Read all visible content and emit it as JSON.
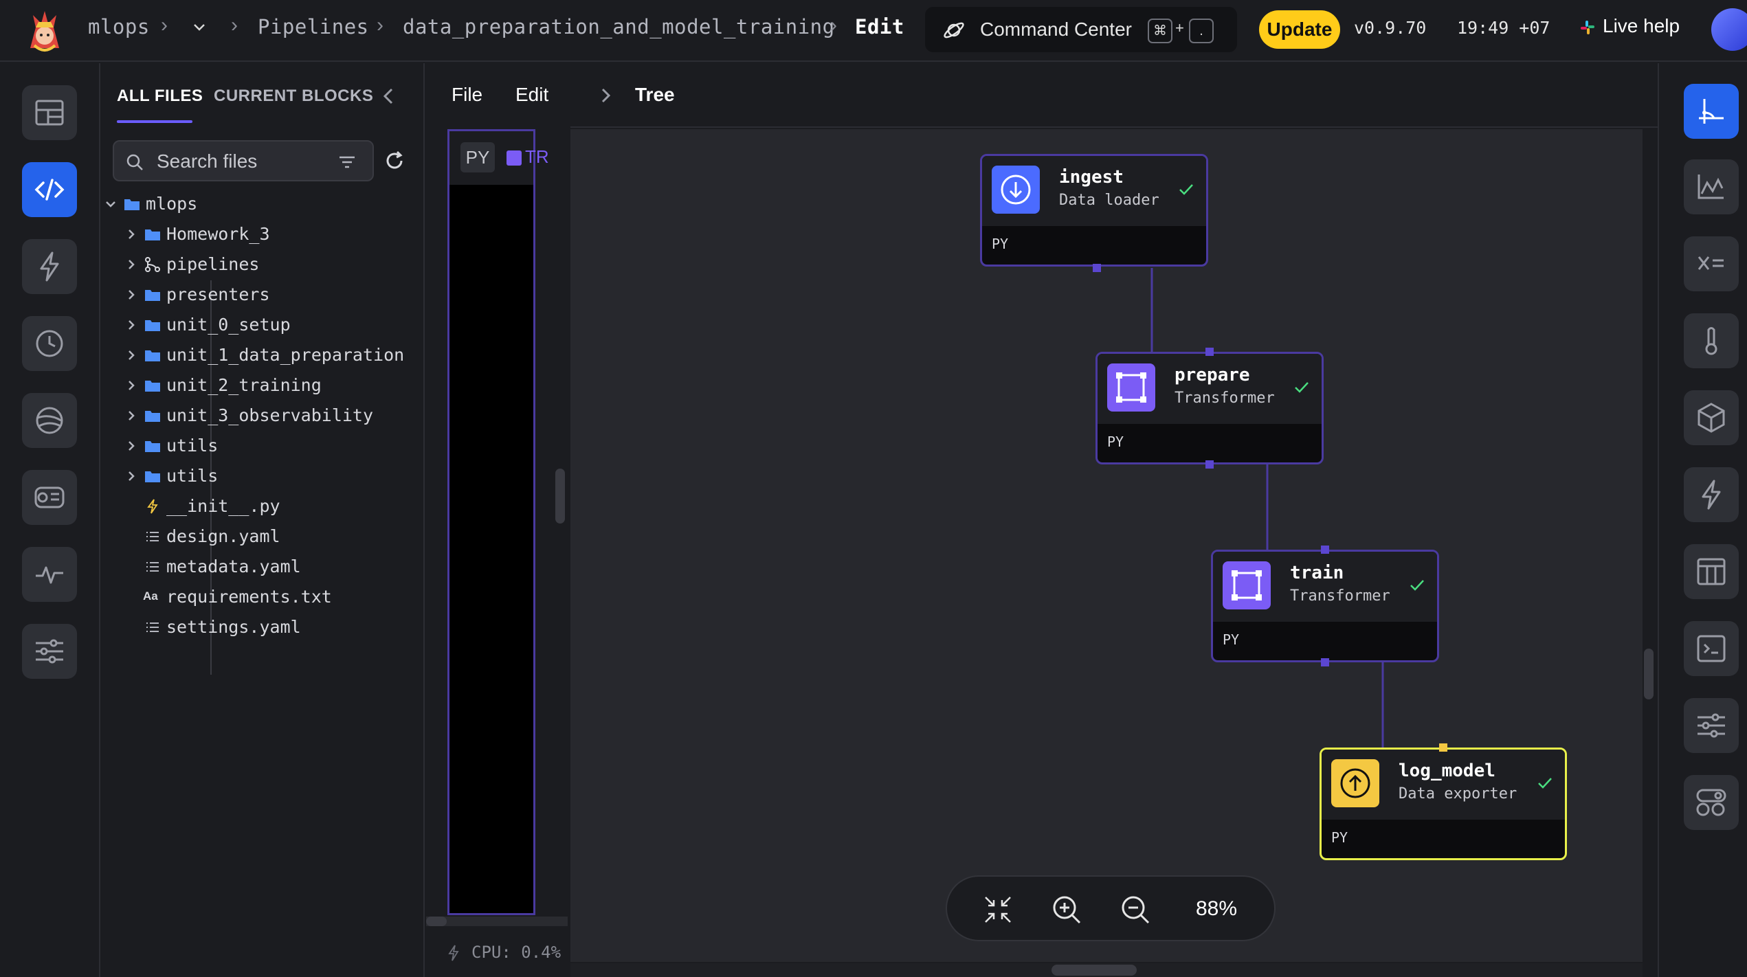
{
  "header": {
    "breadcrumbs": [
      "mlops",
      "Pipelines",
      "data_preparation_and_model_training",
      "Edit"
    ],
    "command_center_label": "Command Center",
    "shortcut_keys": [
      "⌘",
      "+",
      "."
    ],
    "update_label": "Update",
    "version": "v0.9.70",
    "time": "19:49 +07",
    "live_help_label": "Live help"
  },
  "left_rail": {
    "items": [
      "layout-icon",
      "code-icon",
      "bolt-icon",
      "clock-icon",
      "globe-icon",
      "terminal-icon",
      "pulse-icon",
      "sliders-icon"
    ],
    "active": "code-icon"
  },
  "file_panel": {
    "tabs": [
      "ALL FILES",
      "CURRENT BLOCKS"
    ],
    "active_tab": "ALL FILES",
    "search_placeholder": "Search files",
    "tree": {
      "root": "mlops",
      "folders": [
        "Homework_3",
        "pipelines",
        "presenters",
        "unit_0_setup",
        "unit_1_data_preparation",
        "unit_2_training",
        "unit_3_observability",
        "utils"
      ],
      "files": [
        "__init__.py",
        "design.yaml",
        "metadata.yaml",
        "requirements.txt",
        "settings.yaml"
      ]
    }
  },
  "editor": {
    "menu": [
      "File",
      "Edit"
    ],
    "block_tab_lang": "PY",
    "block_tab_type": "TR",
    "cpu_label": "CPU: 0.4%"
  },
  "canvas": {
    "view_label": "Tree",
    "zoom_level": "88%",
    "blocks": [
      {
        "name": "ingest",
        "type": "Data loader",
        "lang": "PY",
        "status": "success",
        "color": "#4b6bff"
      },
      {
        "name": "prepare",
        "type": "Transformer",
        "lang": "PY",
        "status": "success",
        "color": "#7b5cf5"
      },
      {
        "name": "train",
        "type": "Transformer",
        "lang": "PY",
        "status": "success",
        "color": "#7b5cf5"
      },
      {
        "name": "log_model",
        "type": "Data exporter",
        "lang": "PY",
        "status": "success",
        "color": "#f4c842"
      }
    ]
  },
  "right_rail": {
    "items": [
      "tree-icon",
      "chart-icon",
      "variables-icon",
      "thermometer-icon",
      "cube-icon",
      "bolt-icon",
      "table-icon",
      "terminal-icon",
      "settings-icon",
      "toggle-icon"
    ],
    "active": "tree-icon"
  },
  "colors": {
    "accent": "#2563eb",
    "update": "#ffcc19",
    "transformer": "#7b5cf5",
    "exporter": "#f4c842",
    "success": "#4ade80"
  }
}
